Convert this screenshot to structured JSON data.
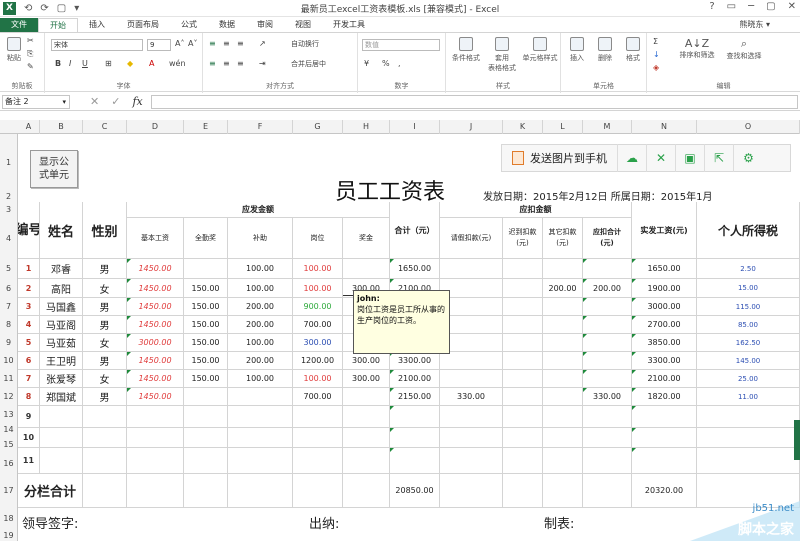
{
  "titlebar": {
    "logo": "X",
    "quick_access": [
      "⟲",
      "⟳",
      "▢",
      "▾"
    ],
    "title": "最新员工excel工资表模板.xls [兼容模式] - Excel",
    "window_buttons": [
      "?",
      "▭",
      "─",
      "▢",
      "✕"
    ]
  },
  "tabs": [
    "文件",
    "开始",
    "插入",
    "页面布局",
    "公式",
    "数据",
    "审阅",
    "视图",
    "开发工具"
  ],
  "user_name": "熊晓东 ▾",
  "ribbon": {
    "clipboard": {
      "paste": "粘贴",
      "label": "剪贴板"
    },
    "font": {
      "name": "宋体",
      "size": "9",
      "grow": "A˄",
      "shrink": "A˅",
      "bold": "B",
      "italic": "I",
      "underline": "U",
      "label": "字体",
      "wen": "wén"
    },
    "alignment": {
      "wrap": "自动换行",
      "merge": "合并后居中",
      "label": "对齐方式"
    },
    "number": {
      "format": "数值",
      "percent": "%",
      "comma": ",",
      "label": "数字"
    },
    "styles": {
      "conditional": "条件格式",
      "table": "套用\n表格格式",
      "cell_styles": "单元格样式",
      "label": "样式"
    },
    "cells": {
      "insert": "插入",
      "delete": "删除",
      "format": "格式",
      "label": "单元格"
    },
    "editing": {
      "sort": "排序和筛选",
      "find": "查找和选择",
      "label": "编辑"
    }
  },
  "formula_bar": {
    "name_box": "备注 2",
    "cancel": "✕",
    "enter": "✓",
    "fx": "fx",
    "content": ""
  },
  "columns": [
    "A",
    "B",
    "C",
    "D",
    "E",
    "F",
    "G",
    "H",
    "I",
    "J",
    "K",
    "L",
    "M",
    "N",
    "O"
  ],
  "rows": [
    "1",
    "2",
    "3",
    "4",
    "5",
    "6",
    "7",
    "8",
    "9",
    "10",
    "11",
    "12",
    "13",
    "14",
    "15",
    "16",
    "17",
    "18",
    "19"
  ],
  "sheet": {
    "show_formula_button": "显示公\n式单元",
    "title": "员工工资表",
    "issue_info": "发放日期：2015年2月12日 所属日期：2015年1月",
    "headers": {
      "no": "编号",
      "name": "姓名",
      "gender": "性别",
      "payable": "应发金额",
      "deduct": "应扣金额",
      "base": "基本工资",
      "attendance": "全勤奖",
      "subsidy": "补助",
      "post": "岗位",
      "bonus": "奖金",
      "total": "合计（元）",
      "leave": "请假扣款(元)",
      "late": "迟到扣款\n(元)",
      "other": "其它扣款\n(元)",
      "deduct_total": "应扣合计\n(元)",
      "net": "实发工资(元)",
      "tax": "个人所得税"
    },
    "data": [
      {
        "no": "1",
        "name": "邓睿",
        "gender": "男",
        "base": "1450.00",
        "attendance": "",
        "subsidy": "100.00",
        "post": "100.00",
        "bonus": "",
        "total": "1650.00",
        "leave": "",
        "late": "",
        "other": "",
        "deduct_total": "",
        "net": "1650.00",
        "tax": "2.50"
      },
      {
        "no": "2",
        "name": "高阳",
        "gender": "女",
        "base": "1450.00",
        "attendance": "150.00",
        "subsidy": "100.00",
        "post": "100.00",
        "bonus": "300.00",
        "total": "2100.00",
        "leave": "",
        "late": "",
        "other": "200.00",
        "deduct_total": "200.00",
        "net": "1900.00",
        "tax": "15.00"
      },
      {
        "no": "3",
        "name": "马国鑫",
        "gender": "男",
        "base": "1450.00",
        "attendance": "150.00",
        "subsidy": "200.00",
        "post": "900.00",
        "bonus": "3",
        "total": "",
        "leave": "",
        "late": "",
        "other": "",
        "deduct_total": "",
        "net": "3000.00",
        "tax": "115.00"
      },
      {
        "no": "4",
        "name": "马亚阁",
        "gender": "男",
        "base": "1450.00",
        "attendance": "150.00",
        "subsidy": "200.00",
        "post": "700.00",
        "bonus": "",
        "total": "",
        "leave": "",
        "late": "",
        "other": "",
        "deduct_total": "",
        "net": "2700.00",
        "tax": "85.00"
      },
      {
        "no": "5",
        "name": "马亚茹",
        "gender": "女",
        "base": "3000.00",
        "attendance": "150.00",
        "subsidy": "100.00",
        "post": "300.00",
        "bonus": "3",
        "total": "",
        "leave": "",
        "late": "",
        "other": "",
        "deduct_total": "",
        "net": "3850.00",
        "tax": "162.50"
      },
      {
        "no": "6",
        "name": "王卫明",
        "gender": "男",
        "base": "1450.00",
        "attendance": "150.00",
        "subsidy": "200.00",
        "post": "1200.00",
        "bonus": "300.00",
        "total": "3300.00",
        "leave": "",
        "late": "",
        "other": "",
        "deduct_total": "",
        "net": "3300.00",
        "tax": "145.00"
      },
      {
        "no": "7",
        "name": "张爱琴",
        "gender": "女",
        "base": "1450.00",
        "attendance": "150.00",
        "subsidy": "100.00",
        "post": "100.00",
        "bonus": "300.00",
        "total": "2100.00",
        "leave": "",
        "late": "",
        "other": "",
        "deduct_total": "",
        "net": "2100.00",
        "tax": "25.00"
      },
      {
        "no": "8",
        "name": "郑国斌",
        "gender": "男",
        "base": "1450.00",
        "attendance": "",
        "subsidy": "",
        "post": "700.00",
        "bonus": "",
        "total": "2150.00",
        "leave": "330.00",
        "late": "",
        "other": "",
        "deduct_total": "330.00",
        "net": "1820.00",
        "tax": "11.00"
      }
    ],
    "empty_nos": [
      "9",
      "10",
      "11"
    ],
    "subtotal_label": "分栏合计",
    "subtotal_total": "20850.00",
    "subtotal_net": "20320.00",
    "footer": {
      "leader": "领导签字:",
      "cashier": "出纳:",
      "maker": "制表:"
    }
  },
  "send_toolbar": {
    "send_label": "发送图片到手机",
    "icons": [
      "cloud-icon",
      "expand-icon",
      "save-icon",
      "share-icon",
      "settings-icon"
    ]
  },
  "comment": {
    "author": "john:",
    "text": "岗位工资是员工所从事的生产岗位的工资。"
  },
  "watermark": {
    "text": "jb51.net",
    "brand": "脚本之家"
  },
  "colors": {
    "excel_green": "#217346",
    "red_value": "#e03c3c",
    "green_value": "#2eaa3c",
    "blue_value": "#2d4fb3",
    "comment_bg": "#ffffe1"
  }
}
